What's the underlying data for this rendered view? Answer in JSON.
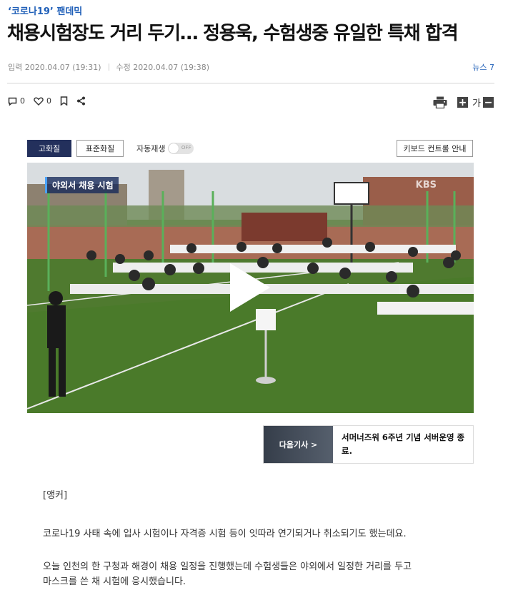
{
  "article": {
    "category": "‘코로나19’ 팬데믹",
    "headline": "채용시험장도 거리 두기… 정용욱, 수험생중 유일한 특채 합격",
    "input_time": "입력 2020.04.07 (19:31)",
    "modified_time": "수정 2020.04.07 (19:38)",
    "press": "뉴스 7"
  },
  "actions": {
    "comment_count": "0",
    "like_count": "0"
  },
  "tools": {
    "font_label": "가"
  },
  "player": {
    "high_quality": "고화질",
    "standard_quality": "표준화질",
    "autoplay_label": "자동재생",
    "autoplay_state": "OFF",
    "keyboard_guide": "키보드 컨트롤 안내",
    "caption": "야외서 채용 시험",
    "broadcaster": "KBS"
  },
  "next_article": {
    "label": "다음기사 >",
    "title": "서머너즈워 6주년 기념 서버운영 종료."
  },
  "body": {
    "p1": "[앵커]",
    "p2": "코로나19 사태 속에 입사 시험이나 자격증 시험 등이 잇따라 연기되거나 취소되기도 했는데요.",
    "p3a": "오늘 인천의 한 구청과 해경이 채용 일정을 진행했는데 수험생들은 야외에서 일정한 거리를 두고",
    "p3b": "마스크를 쓴 채 시험에 응시했습니다."
  },
  "colors": {
    "accent": "#1f5fb8",
    "button_active": "#23305c"
  }
}
